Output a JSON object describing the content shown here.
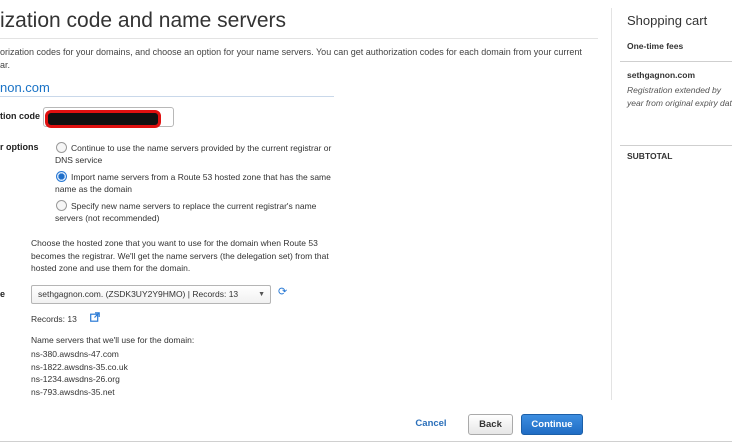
{
  "header": {
    "title": "ization code and name servers",
    "intro": "orization codes for your domains, and choose an option for your name servers. You can get authorization codes for each domain from your current",
    "intro_line2": "ar."
  },
  "domain_section": {
    "domain": "non.com",
    "auth_code_label": "tion code",
    "name_server_options_label": "r options",
    "options": [
      "Continue to use the name servers provided by the current registrar or DNS service",
      "Import name servers from a Route 53 hosted zone that has the same name as the domain",
      "Specify new name servers to replace the current registrar's name servers (not recommended)"
    ],
    "selected_option": 1,
    "hosted_zone_help": "Choose the hosted zone that you want to use for the domain when Route 53 becomes the registrar. We'll get the name servers (the delegation set) from that hosted zone and use them for the domain.",
    "hosted_zone_label": "e",
    "hosted_zone_value": "sethgagnon.com. (ZSDK3UY2Y9HMO) | Records: 13",
    "records_text": "Records: 13",
    "name_servers_intro": "Name servers that we'll use for the domain:",
    "name_servers": [
      "ns-380.awsdns-47.com",
      "ns-1822.awsdns-35.co.uk",
      "ns-1234.awsdns-26.org",
      "ns-793.awsdns-35.net"
    ]
  },
  "actions": {
    "cancel": "Cancel",
    "back": "Back",
    "continue": "Continue"
  },
  "cart": {
    "title": "Shopping cart",
    "subtitle": "One-time fees",
    "domain": "sethgagnon.com",
    "description": "Registration extended by year from original expiry date",
    "subtotal": "SUBTOTAL"
  },
  "colors": {
    "link_blue": "#1a73c6",
    "primary_button": "#1f6cc4",
    "redaction_outline": "#e01010"
  }
}
